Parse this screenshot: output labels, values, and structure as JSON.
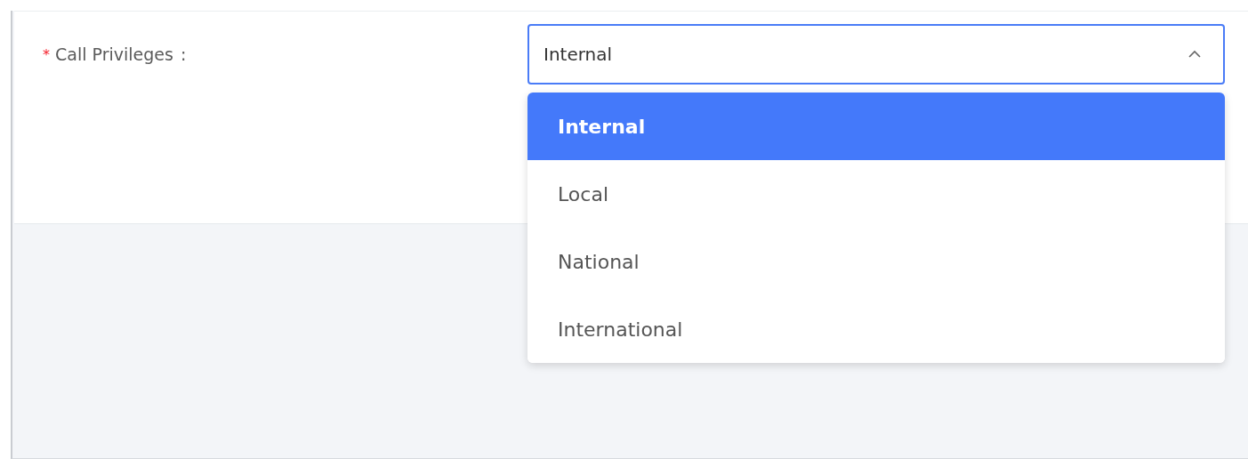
{
  "field": {
    "required_mark": "*",
    "label": "Call Privileges",
    "colon": ":",
    "value": "Internal",
    "expanded": true
  },
  "options": [
    {
      "label": "Internal",
      "selected": true
    },
    {
      "label": "Local",
      "selected": false
    },
    {
      "label": "National",
      "selected": false
    },
    {
      "label": "International",
      "selected": false
    }
  ]
}
